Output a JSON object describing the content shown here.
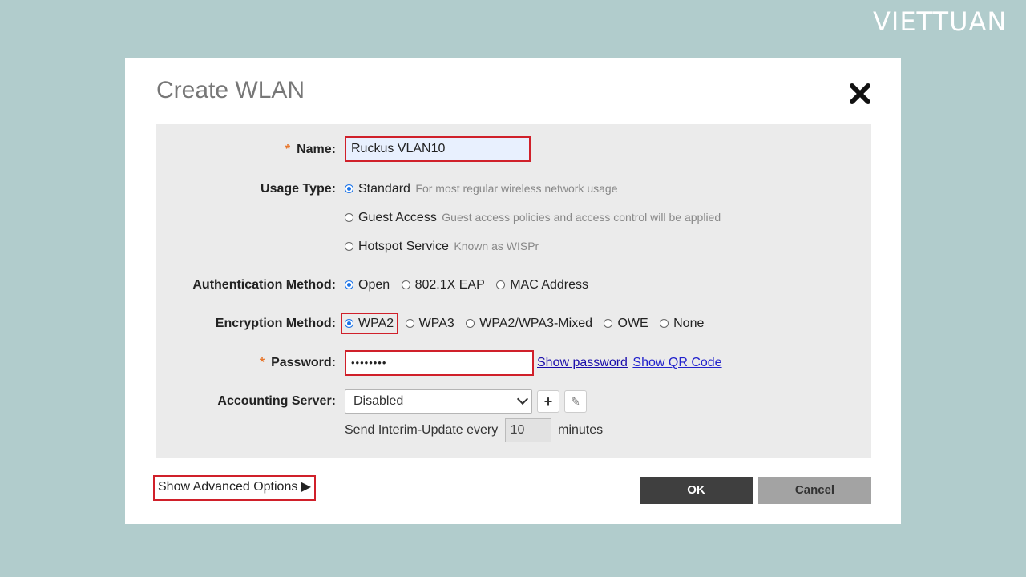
{
  "brand": "VIETTUAN",
  "dialog": {
    "title": "Create WLAN",
    "name": {
      "label": "Name:",
      "value": "Ruckus VLAN10"
    },
    "usage_type": {
      "label": "Usage Type:",
      "options": [
        {
          "label": "Standard",
          "hint": "For most regular wireless network usage",
          "checked": true
        },
        {
          "label": "Guest Access",
          "hint": "Guest access policies and access control will be applied",
          "checked": false
        },
        {
          "label": "Hotspot Service",
          "hint": "Known as WISPr",
          "checked": false
        }
      ]
    },
    "auth_method": {
      "label": "Authentication Method:",
      "options": [
        "Open",
        "802.1X EAP",
        "MAC Address"
      ],
      "selected": "Open"
    },
    "encryption_method": {
      "label": "Encryption Method:",
      "options": [
        "WPA2",
        "WPA3",
        "WPA2/WPA3-Mixed",
        "OWE",
        "None"
      ],
      "selected": "WPA2"
    },
    "password": {
      "label": "Password:",
      "value": "••••••••",
      "show_password": "Show password",
      "show_qr": "Show QR Code"
    },
    "accounting": {
      "label": "Accounting Server:",
      "selected": "Disabled",
      "interim_prefix": "Send Interim-Update every",
      "interim_value": "10",
      "interim_suffix": "minutes"
    },
    "advanced": "Show Advanced Options ▶",
    "ok": "OK",
    "cancel": "Cancel"
  }
}
